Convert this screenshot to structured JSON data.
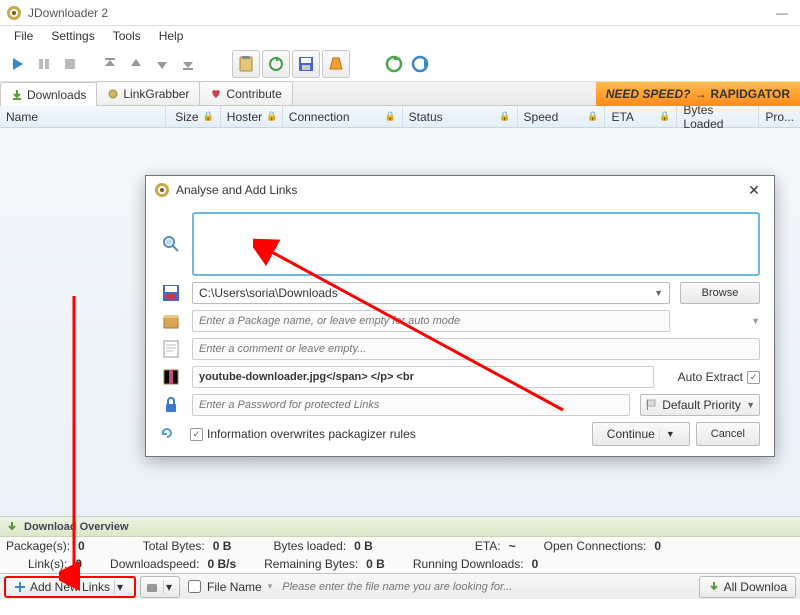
{
  "window": {
    "title": "JDownloader 2"
  },
  "menu": {
    "file": "File",
    "settings": "Settings",
    "tools": "Tools",
    "help": "Help"
  },
  "tabs": {
    "downloads": "Downloads",
    "linkgrabber": "LinkGrabber",
    "contribute": "Contribute",
    "banner_left": "NEED SPEED?",
    "banner_right": "RAPIDGATOR"
  },
  "cols": {
    "name": "Name",
    "size": "Size",
    "hoster": "Hoster",
    "connection": "Connection",
    "status": "Status",
    "speed": "Speed",
    "eta": "ETA",
    "bytesloaded": "Bytes Loaded",
    "pro": "Pro..."
  },
  "overview": {
    "title": "Download Overview",
    "packages": "Package(s):",
    "packages_v": "0",
    "links": "Link(s):",
    "links_v": "0",
    "totalbytes": "Total Bytes:",
    "totalbytes_v": "0 B",
    "downloadspeed": "Downloadspeed:",
    "downloadspeed_v": "0 B/s",
    "bytesloaded": "Bytes loaded:",
    "bytesloaded_v": "0 B",
    "remaining": "Remaining Bytes:",
    "remaining_v": "0 B",
    "eta": "ETA:",
    "eta_v": "~",
    "running": "Running Downloads:",
    "running_v": "0",
    "open": "Open Connections:",
    "open_v": "0"
  },
  "bottom": {
    "add_links": "Add New Links",
    "file_name": "File Name",
    "search_placeholder": "Please enter the file name you are looking for...",
    "all_downloads": "All Downloa"
  },
  "dialog": {
    "title": "Analyse and Add Links",
    "links_value": "",
    "savepath": "C:\\Users\\soria\\Downloads",
    "browse": "Browse",
    "pkg_placeholder": "Enter a Package name, or leave empty for auto mode",
    "comment_placeholder": "Enter a comment or leave empty...",
    "archive_value": "youtube-downloader.jpg</span> </p> <br",
    "auto_extract": "Auto Extract",
    "pwd_placeholder": "Enter a Password for protected Links",
    "priority": "Default Priority",
    "overwrite": "Information overwrites packagizer rules",
    "continue": "Continue",
    "cancel": "Cancel"
  }
}
